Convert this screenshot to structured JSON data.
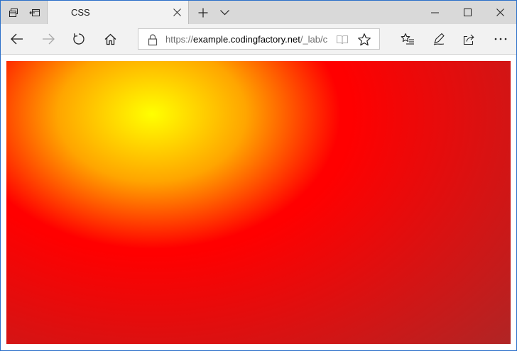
{
  "tab": {
    "title": "CSS",
    "icons": [
      "tab-preview-icon",
      "set-tabs-aside-icon"
    ]
  },
  "titlebar": {
    "new_tab_icon": "plus-icon",
    "tab_list_icon": "chevron-down-icon",
    "minimize_icon": "minimize-icon",
    "maximize_icon": "maximize-icon",
    "close_icon": "close-icon"
  },
  "navbar": {
    "back_icon": "arrow-left-icon",
    "forward_icon": "arrow-right-icon",
    "refresh_icon": "refresh-icon",
    "home_icon": "home-icon",
    "address": {
      "protocol": "https://",
      "host": "example.codingfactory.net",
      "path": "/_lab/c"
    },
    "reading_view_icon": "reading-view-icon",
    "favorite_icon": "star-icon",
    "favorites_hub_icon": "favorites-hub-icon",
    "notes_icon": "pen-icon",
    "share_icon": "share-icon",
    "more_icon": "more-icon"
  },
  "page": {
    "gradient": {
      "type": "radial",
      "colors": [
        "#ffff00",
        "#ffa500",
        "#ff0000",
        "#a52a2a"
      ]
    }
  },
  "colors": {
    "window_border": "#2b6fc9",
    "titlebar_bg": "#d9d9d9",
    "active_tab_bg": "#f2f2f2"
  }
}
